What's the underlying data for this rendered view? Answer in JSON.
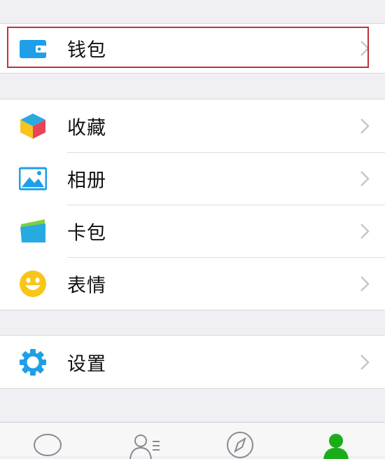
{
  "wallet": {
    "label": "钱包",
    "icon": "wallet-icon"
  },
  "menu": [
    {
      "label": "收藏",
      "icon": "favorites-cube-icon"
    },
    {
      "label": "相册",
      "icon": "album-picture-icon"
    },
    {
      "label": "卡包",
      "icon": "card-package-icon"
    },
    {
      "label": "表情",
      "icon": "smiley-emoji-icon"
    }
  ],
  "settings": {
    "label": "设置",
    "icon": "gear-icon"
  },
  "tabbar": [
    "chat-bubble-icon",
    "contacts-icon",
    "discover-compass-icon",
    "me-person-icon"
  ],
  "colors": {
    "highlight": "#c0313a",
    "accent": "#1aad19",
    "icon_blue": "#1e9fe8"
  }
}
